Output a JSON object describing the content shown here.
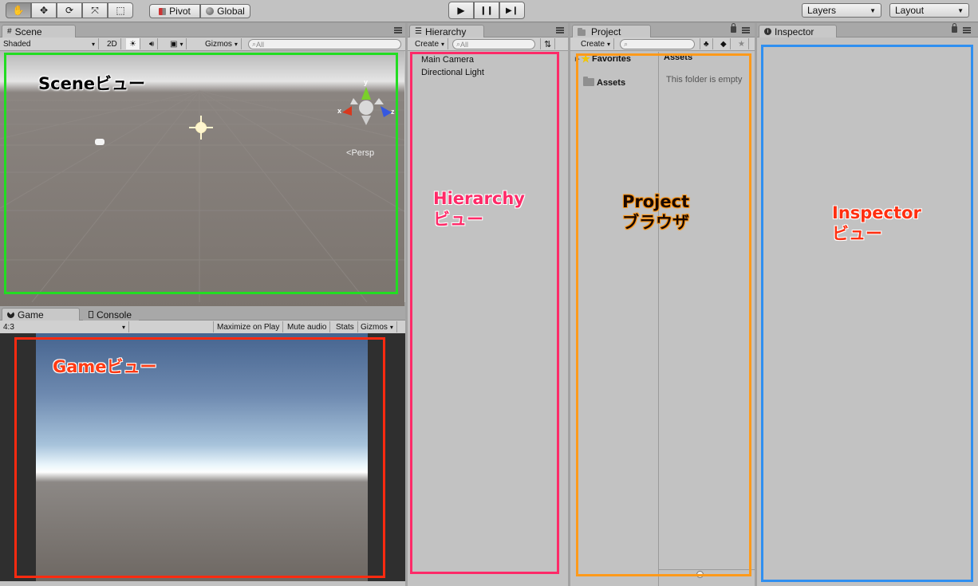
{
  "toolbar": {
    "tools": [
      {
        "icon": "hand-icon",
        "glyph": "✋"
      },
      {
        "icon": "move-icon",
        "glyph": "✥"
      },
      {
        "icon": "rotate-icon",
        "glyph": "⟳"
      },
      {
        "icon": "scale-icon",
        "glyph": "⤧"
      },
      {
        "icon": "rect-icon",
        "glyph": "⬚"
      }
    ],
    "pivot_label": "Pivot",
    "global_label": "Global",
    "play_glyph": "▶",
    "pause_glyph": "❙❙",
    "step_glyph": "▶❙",
    "layers_label": "Layers",
    "layout_label": "Layout"
  },
  "scene": {
    "tab_label": "Scene",
    "shading_label": "Shaded",
    "mode_2d_label": "2D",
    "gizmos_label": "Gizmos",
    "search_placeholder": "All",
    "persp_label": "Persp",
    "axis_x": "x",
    "axis_y": "y",
    "axis_z": "z"
  },
  "game": {
    "tab_label": "Game",
    "console_tab_label": "Console",
    "aspect_label": "4:3",
    "maximize_label": "Maximize on Play",
    "mute_label": "Mute audio",
    "stats_label": "Stats",
    "gizmos_label": "Gizmos"
  },
  "hierarchy": {
    "tab_label": "Hierarchy",
    "create_label": "Create",
    "search_placeholder": "All",
    "items": [
      "Main Camera",
      "Directional Light"
    ]
  },
  "project": {
    "tab_label": "Project",
    "create_label": "Create",
    "favorites_label": "Favorites",
    "assets_tree_label": "Assets",
    "assets_header": "Assets",
    "empty_text": "This folder is empty"
  },
  "inspector": {
    "tab_label": "Inspector"
  },
  "annotations": {
    "scene": "Sceneビュー",
    "game": "Gameビュー",
    "hierarchy_line1": "Hierarchy",
    "hierarchy_line2": "ビュー",
    "project_line1": "Project",
    "project_line2": "ブラウザ",
    "inspector_line1": "Inspector",
    "inspector_line2": "ビュー"
  },
  "colors": {
    "scene_box": "#22dd22",
    "game_box": "#ff2a10",
    "hierarchy_box": "#ff2a68",
    "project_box": "#ff9a1a",
    "inspector_box": "#2f8ff0"
  }
}
